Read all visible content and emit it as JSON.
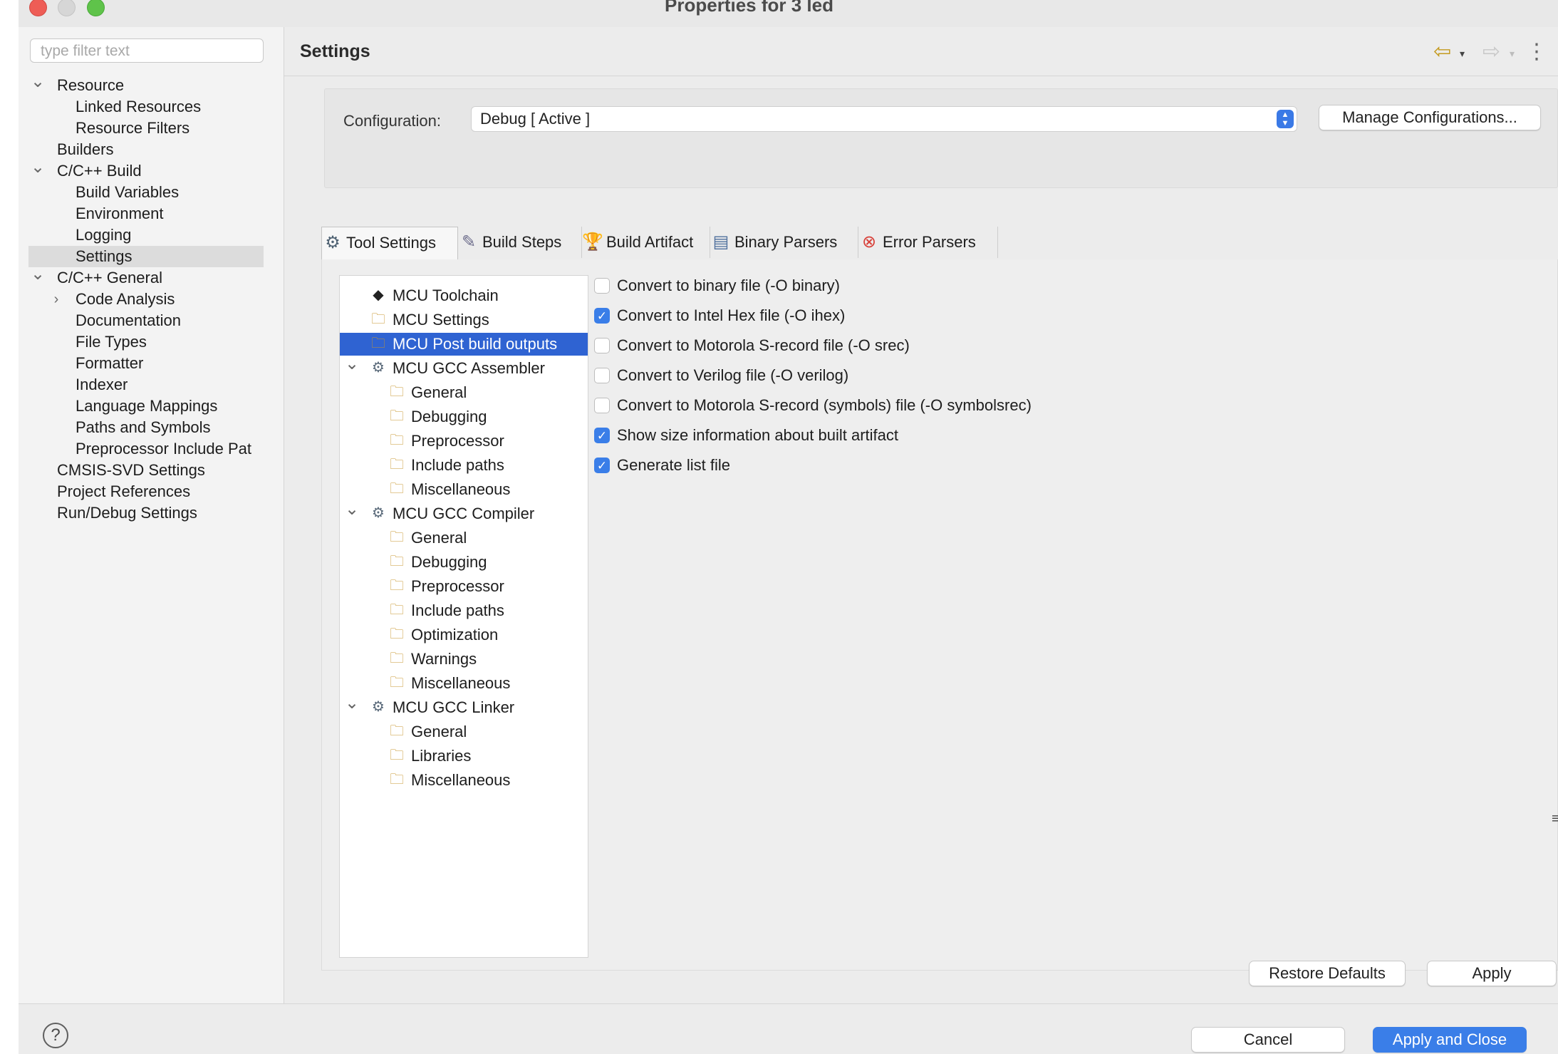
{
  "window": {
    "title": "Properties for 3 led"
  },
  "filter": {
    "placeholder": "type filter text"
  },
  "nav": {
    "items": [
      {
        "label": "Resource",
        "expanded": true
      },
      {
        "label": "Linked Resources"
      },
      {
        "label": "Resource Filters"
      },
      {
        "label": "Builders"
      },
      {
        "label": "C/C++ Build",
        "expanded": true
      },
      {
        "label": "Build Variables"
      },
      {
        "label": "Environment"
      },
      {
        "label": "Logging"
      },
      {
        "label": "Settings",
        "selected": true
      },
      {
        "label": "C/C++ General",
        "expanded": true
      },
      {
        "label": "Code Analysis",
        "expanded": false
      },
      {
        "label": "Documentation"
      },
      {
        "label": "File Types"
      },
      {
        "label": "Formatter"
      },
      {
        "label": "Indexer"
      },
      {
        "label": "Language Mappings"
      },
      {
        "label": "Paths and Symbols"
      },
      {
        "label": "Preprocessor Include Pat"
      },
      {
        "label": "CMSIS-SVD Settings"
      },
      {
        "label": "Project References"
      },
      {
        "label": "Run/Debug Settings"
      }
    ]
  },
  "header": {
    "title": "Settings"
  },
  "config": {
    "label": "Configuration:",
    "value": "Debug  [ Active ]",
    "manage_button": "Manage Configurations..."
  },
  "tabs": [
    {
      "label": "Tool Settings",
      "icon": "tool-settings-icon",
      "active": true
    },
    {
      "label": "Build Steps",
      "icon": "build-steps-icon"
    },
    {
      "label": "Build Artifact",
      "icon": "build-artifact-icon"
    },
    {
      "label": "Binary Parsers",
      "icon": "binary-parsers-icon"
    },
    {
      "label": "Error Parsers",
      "icon": "error-parsers-icon"
    }
  ],
  "tool_tree": [
    {
      "label": "MCU Toolchain",
      "icon": "chip-icon"
    },
    {
      "label": "MCU Settings",
      "icon": "folder-gear-icon"
    },
    {
      "label": "MCU Post build outputs",
      "icon": "folder-gear-icon",
      "selected": true
    },
    {
      "label": "MCU GCC Assembler",
      "icon": "gear-icon",
      "expanded": true
    },
    {
      "label": "General",
      "icon": "folder-gear-icon"
    },
    {
      "label": "Debugging",
      "icon": "folder-gear-icon"
    },
    {
      "label": "Preprocessor",
      "icon": "folder-gear-icon"
    },
    {
      "label": "Include paths",
      "icon": "folder-gear-icon"
    },
    {
      "label": "Miscellaneous",
      "icon": "folder-gear-icon"
    },
    {
      "label": "MCU GCC Compiler",
      "icon": "gear-icon",
      "expanded": true
    },
    {
      "label": "General",
      "icon": "folder-gear-icon"
    },
    {
      "label": "Debugging",
      "icon": "folder-gear-icon"
    },
    {
      "label": "Preprocessor",
      "icon": "folder-gear-icon"
    },
    {
      "label": "Include paths",
      "icon": "folder-gear-icon"
    },
    {
      "label": "Optimization",
      "icon": "folder-gear-icon"
    },
    {
      "label": "Warnings",
      "icon": "folder-gear-icon"
    },
    {
      "label": "Miscellaneous",
      "icon": "folder-gear-icon"
    },
    {
      "label": "MCU GCC Linker",
      "icon": "gear-icon",
      "expanded": true
    },
    {
      "label": "General",
      "icon": "folder-gear-icon"
    },
    {
      "label": "Libraries",
      "icon": "folder-gear-icon"
    },
    {
      "label": "Miscellaneous",
      "icon": "folder-gear-icon"
    }
  ],
  "options": [
    {
      "label": "Convert to binary file (-O binary)",
      "checked": false
    },
    {
      "label": "Convert to Intel Hex file (-O ihex)",
      "checked": true
    },
    {
      "label": "Convert to Motorola S-record file (-O srec)",
      "checked": false
    },
    {
      "label": "Convert to Verilog file (-O verilog)",
      "checked": false
    },
    {
      "label": "Convert to Motorola S-record (symbols) file (-O symbolsrec)",
      "checked": false
    },
    {
      "label": "Show size information about built artifact",
      "checked": true
    },
    {
      "label": "Generate list file",
      "checked": true
    }
  ],
  "buttons": {
    "restore_defaults": "Restore Defaults",
    "apply": "Apply",
    "cancel": "Cancel",
    "apply_and_close": "Apply and Close"
  },
  "colors": {
    "accent": "#3a7ee8",
    "selection": "#2f63d2",
    "close": "#ee5d56",
    "maximize": "#5fc34a"
  }
}
